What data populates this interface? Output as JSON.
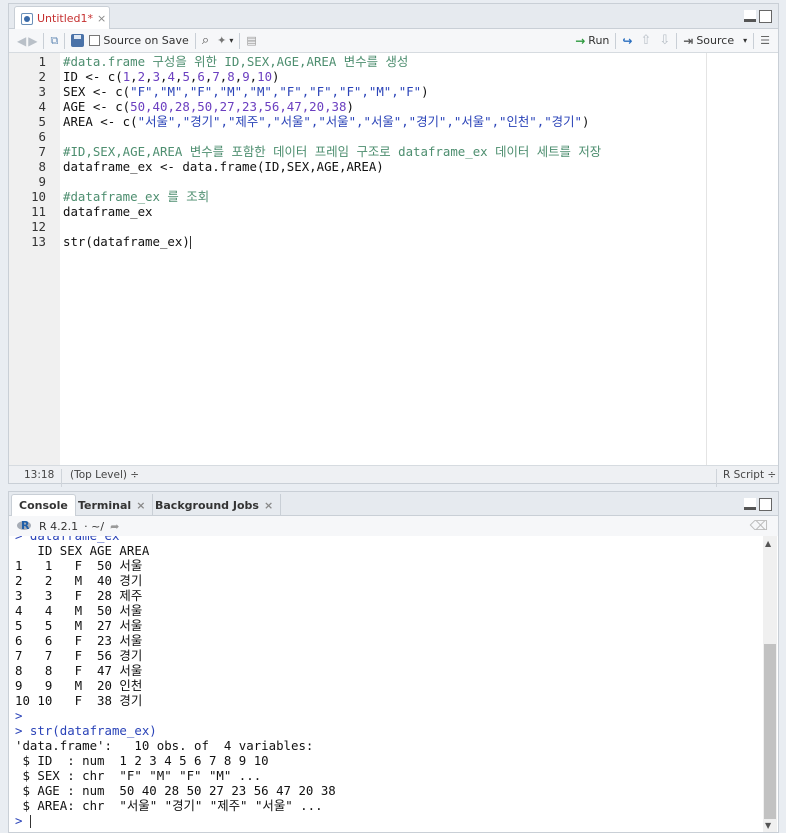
{
  "source_pane": {
    "tab_title": "Untitled1*",
    "close_glyph": "×",
    "toolbar": {
      "source_on_save_label": "Source on Save",
      "run_label": "Run",
      "source_label": "Source"
    },
    "lines": [
      {
        "n": "1",
        "parts": [
          {
            "t": "#data.frame 구성을 위한 ID,SEX,AGE,AREA 변수를 생성",
            "c": "cmt"
          }
        ]
      },
      {
        "n": "2",
        "parts": [
          {
            "t": "ID <- c(",
            "c": "fn"
          },
          {
            "t": "1",
            "c": "num"
          },
          {
            "t": ",",
            "c": "fn"
          },
          {
            "t": "2",
            "c": "num"
          },
          {
            "t": ",",
            "c": "fn"
          },
          {
            "t": "3",
            "c": "num"
          },
          {
            "t": ",",
            "c": "fn"
          },
          {
            "t": "4",
            "c": "num"
          },
          {
            "t": ",",
            "c": "fn"
          },
          {
            "t": "5",
            "c": "num"
          },
          {
            "t": ",",
            "c": "fn"
          },
          {
            "t": "6",
            "c": "num"
          },
          {
            "t": ",",
            "c": "fn"
          },
          {
            "t": "7",
            "c": "num"
          },
          {
            "t": ",",
            "c": "fn"
          },
          {
            "t": "8",
            "c": "num"
          },
          {
            "t": ",",
            "c": "fn"
          },
          {
            "t": "9",
            "c": "num"
          },
          {
            "t": ",",
            "c": "fn"
          },
          {
            "t": "10",
            "c": "num"
          },
          {
            "t": ")",
            "c": "fn"
          }
        ]
      },
      {
        "n": "3",
        "parts": [
          {
            "t": "SEX <- c(",
            "c": "fn"
          },
          {
            "t": "\"F\",\"M\",\"F\",\"M\",\"M\",\"F\",\"F\",\"F\",\"M\",\"F\"",
            "c": "str"
          },
          {
            "t": ")",
            "c": "fn"
          }
        ]
      },
      {
        "n": "4",
        "parts": [
          {
            "t": "AGE <- c(",
            "c": "fn"
          },
          {
            "t": "50,40,28,50,27,23,56,47,20,38",
            "c": "num"
          },
          {
            "t": ")",
            "c": "fn"
          }
        ]
      },
      {
        "n": "5",
        "parts": [
          {
            "t": "AREA <- c(",
            "c": "fn"
          },
          {
            "t": "\"서울\",\"경기\",\"제주\",\"서울\",\"서울\",\"서울\",\"경기\",\"서울\",\"인천\",\"경기\"",
            "c": "str"
          },
          {
            "t": ")",
            "c": "fn"
          }
        ]
      },
      {
        "n": "6",
        "parts": []
      },
      {
        "n": "7",
        "parts": [
          {
            "t": "#ID,SEX,AGE,AREA 변수를 포함한 데이터 프레임 구조로 dataframe_ex 데이터 세트를 저장",
            "c": "cmt"
          }
        ]
      },
      {
        "n": "8",
        "parts": [
          {
            "t": "dataframe_ex <- data.frame(ID,SEX,AGE,AREA)",
            "c": "fn"
          }
        ]
      },
      {
        "n": "9",
        "parts": []
      },
      {
        "n": "10",
        "parts": [
          {
            "t": "#dataframe_ex 를 조회",
            "c": "cmt"
          }
        ]
      },
      {
        "n": "11",
        "parts": [
          {
            "t": "dataframe_ex",
            "c": "fn"
          }
        ]
      },
      {
        "n": "12",
        "parts": []
      },
      {
        "n": "13",
        "parts": [
          {
            "t": "str(dataframe_ex)",
            "c": "fn"
          }
        ]
      }
    ],
    "status": {
      "position": "13:18",
      "scope": "(Top Level) ÷",
      "filetype": "R Script ÷"
    }
  },
  "console_pane": {
    "tabs": [
      {
        "label": "Console"
      },
      {
        "label": "Terminal"
      },
      {
        "label": "Background Jobs"
      }
    ],
    "r_version": "R 4.2.1",
    "working_dir": "· ~/",
    "lines": [
      "> dataframe_ex",
      "   ID SEX AGE AREA",
      "1   1   F  50 서울",
      "2   2   M  40 경기",
      "3   3   F  28 제주",
      "4   4   M  50 서울",
      "5   5   M  27 서울",
      "6   6   F  23 서울",
      "7   7   F  56 경기",
      "8   8   F  47 서울",
      "9   9   M  20 인천",
      "10 10   F  38 경기",
      ">",
      "> str(dataframe_ex)",
      "'data.frame':\t10 obs. of  4 variables:",
      " $ ID  : num  1 2 3 4 5 6 7 8 9 10",
      " $ SEX : chr  \"F\" \"M\" \"F\" \"M\" ...",
      " $ AGE : num  50 40 28 50 27 23 56 47 20 38",
      " $ AREA: chr  \"서울\" \"경기\" \"제주\" \"서울\" ...",
      "> "
    ]
  }
}
